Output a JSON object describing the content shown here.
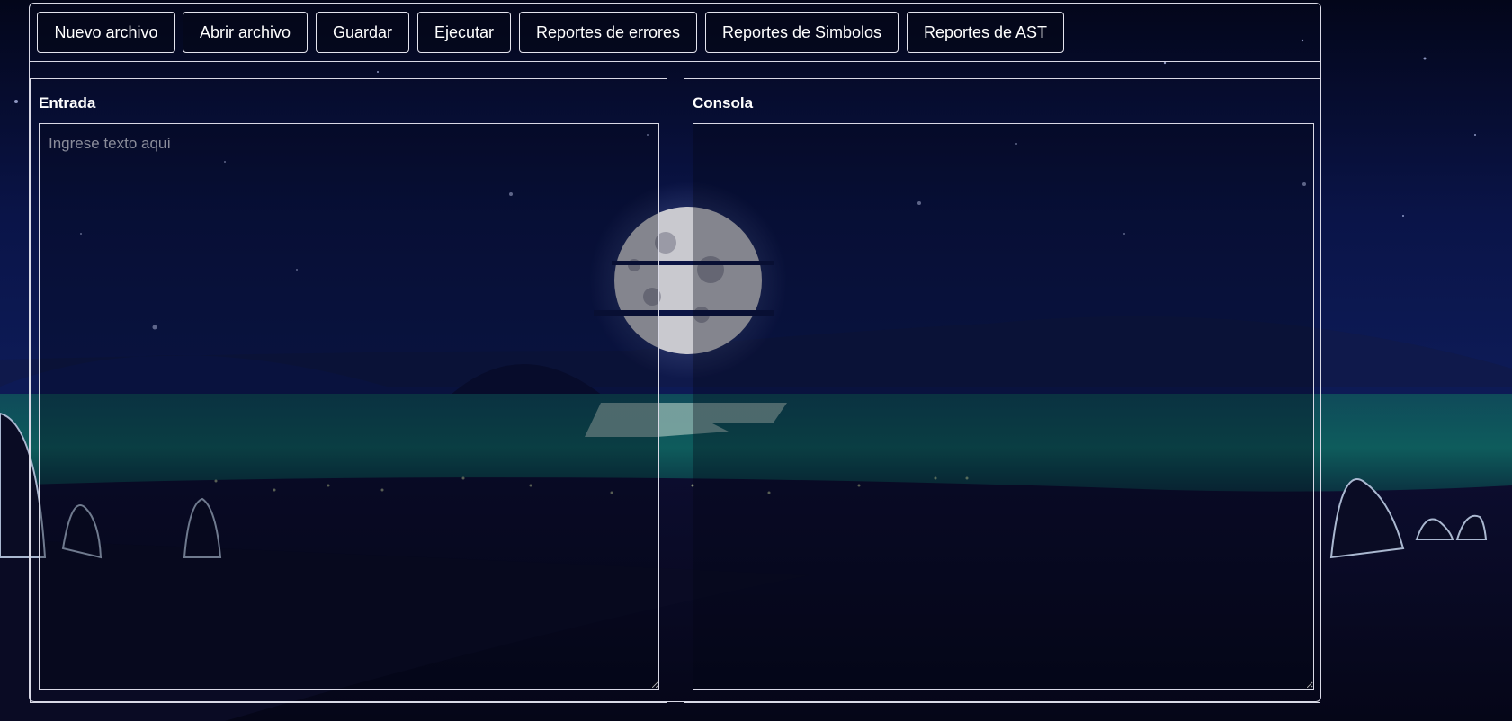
{
  "toolbar": {
    "buttons": [
      {
        "label": "Nuevo archivo"
      },
      {
        "label": "Abrir archivo"
      },
      {
        "label": "Guardar"
      },
      {
        "label": "Ejecutar"
      },
      {
        "label": "Reportes de errores"
      },
      {
        "label": "Reportes de Simbolos"
      },
      {
        "label": "Reportes de AST"
      }
    ]
  },
  "entrada": {
    "title": "Entrada",
    "placeholder": "Ingrese texto aquí",
    "value": ""
  },
  "consola": {
    "title": "Consola",
    "value": ""
  },
  "colors": {
    "background_sky": "#0a1140",
    "border": "#d9d9e6",
    "text": "#ffffff",
    "placeholder": "#8a8c9a"
  }
}
